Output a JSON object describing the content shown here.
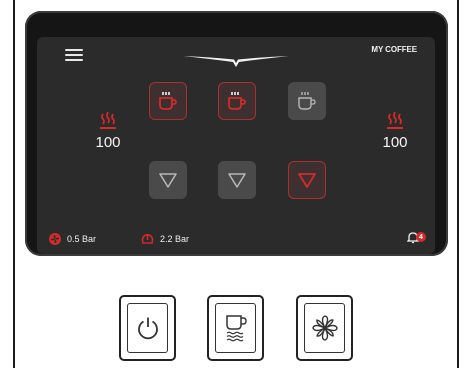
{
  "header": {
    "title": "MY COFFEE"
  },
  "boilers": {
    "left": {
      "value": "100"
    },
    "right": {
      "value": "100"
    }
  },
  "grid": {
    "top_row": [
      {
        "icon": "coffee-cup-steam-icon",
        "state": "active"
      },
      {
        "icon": "coffee-cup-steam-icon",
        "state": "active"
      },
      {
        "icon": "coffee-cup-steam-icon",
        "state": "inactive"
      }
    ],
    "bottom_row": [
      {
        "icon": "triangle-down-icon",
        "state": "inactive"
      },
      {
        "icon": "triangle-down-icon",
        "state": "inactive"
      },
      {
        "icon": "triangle-down-icon",
        "state": "active"
      }
    ]
  },
  "status": {
    "fan_pressure": "0.5 Bar",
    "pump_pressure": "2.2 Bar",
    "notification_count": "4"
  },
  "hardware_buttons": [
    {
      "icon": "power-icon"
    },
    {
      "icon": "cup-warmer-icon"
    },
    {
      "icon": "fan-icon"
    }
  ],
  "colors": {
    "accent": "#d42a2a",
    "screen_bg": "#2b2b2b",
    "tile_inactive": "#4a4a4a"
  }
}
